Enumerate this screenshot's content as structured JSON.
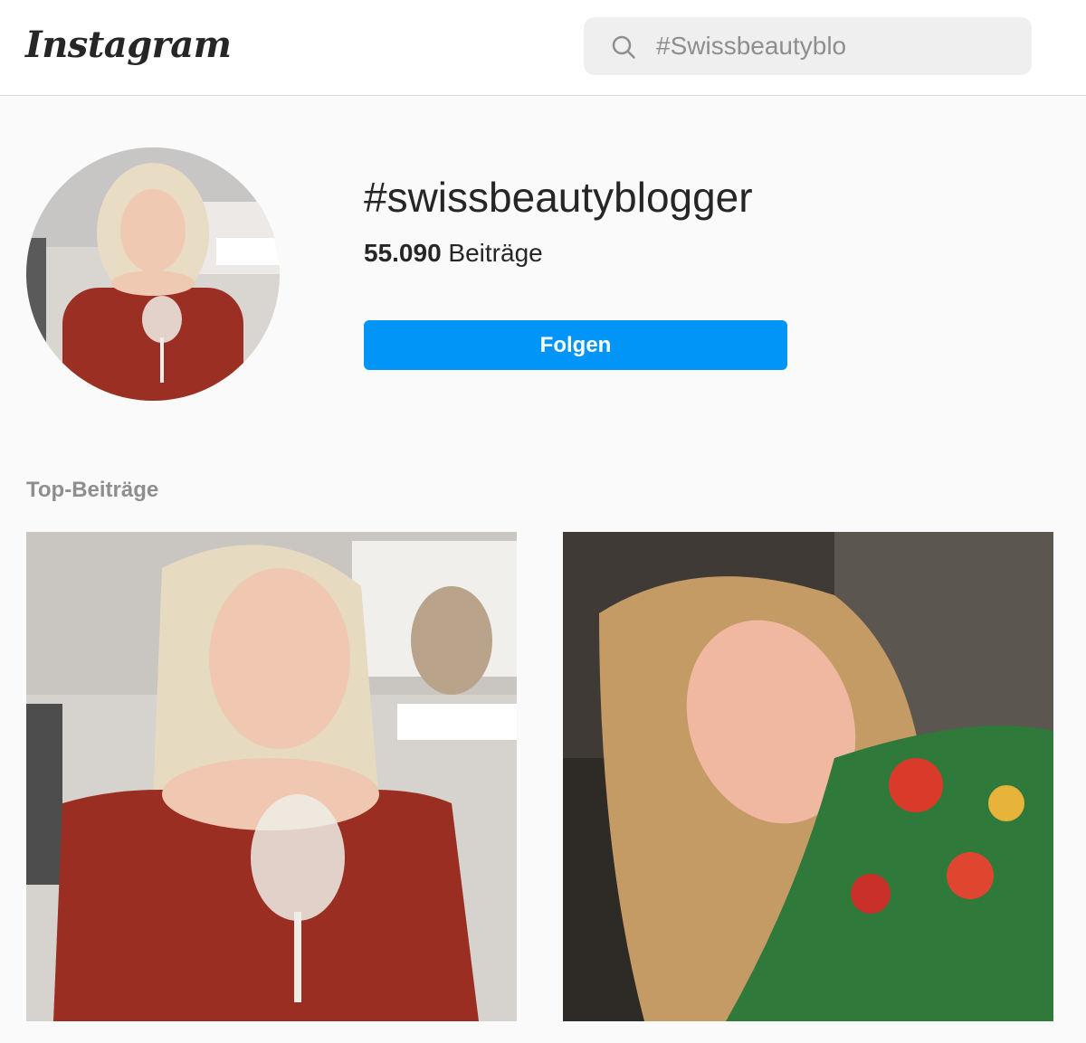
{
  "header": {
    "logo_text": "Instagram",
    "search": {
      "value": "#Swissbeautyblo",
      "icon": "search-icon"
    }
  },
  "hashtag": {
    "title": "#swissbeautyblogger",
    "post_count": "55.090",
    "post_count_label": "Beiträge",
    "follow_label": "Folgen"
  },
  "top_posts": {
    "title": "Top-Beiträge"
  },
  "colors": {
    "accent": "#0095f6",
    "text": "#262626",
    "muted": "#8e8e8e",
    "background": "#fafafa"
  }
}
